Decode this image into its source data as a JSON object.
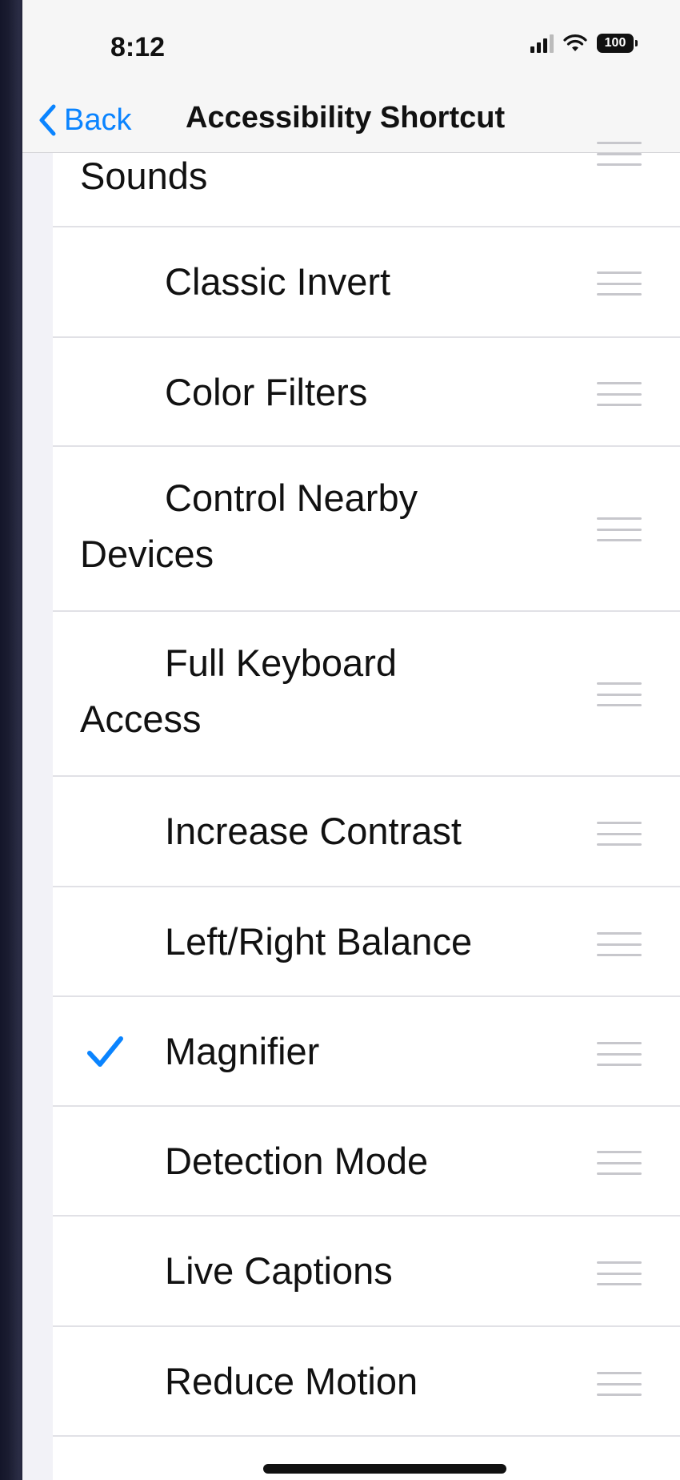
{
  "status_bar": {
    "time": "8:12",
    "battery": "100"
  },
  "nav": {
    "back_label": "Back",
    "title": "Accessibility Shortcut"
  },
  "items": [
    {
      "label": "Sounds",
      "checked": false
    },
    {
      "label": "Classic Invert",
      "checked": false
    },
    {
      "label": "Color Filters",
      "checked": false
    },
    {
      "label": "Control Nearby Devices",
      "checked": false
    },
    {
      "label": "Full Keyboard Access",
      "checked": false
    },
    {
      "label": "Increase Contrast",
      "checked": false
    },
    {
      "label": "Left/Right Balance",
      "checked": false
    },
    {
      "label": "Magnifier",
      "checked": true
    },
    {
      "label": "Detection Mode",
      "checked": false
    },
    {
      "label": "Live Captions",
      "checked": false
    },
    {
      "label": "Reduce Motion",
      "checked": false
    }
  ],
  "colors": {
    "accent": "#0a84ff",
    "background": "#f2f2f7",
    "separator": "#e1e1e6"
  },
  "icons": {
    "back": "chevron-left-icon",
    "check": "checkmark-icon",
    "reorder": "reorder-handle-icon"
  }
}
